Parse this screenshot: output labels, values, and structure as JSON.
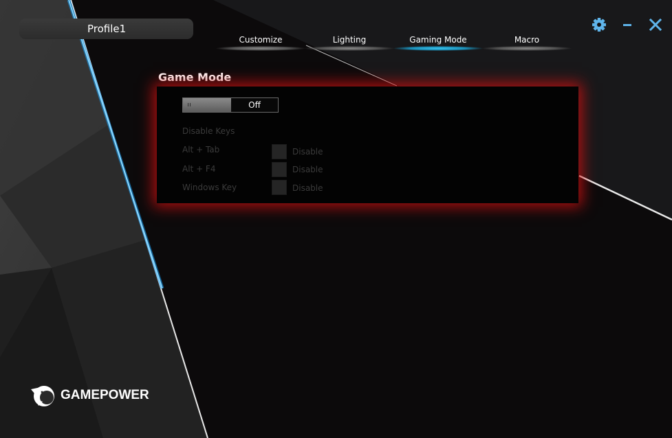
{
  "profile": {
    "name": "Profile1"
  },
  "tabs": [
    {
      "label": "Customize",
      "active": false
    },
    {
      "label": "Lighting",
      "active": false
    },
    {
      "label": "Gaming Mode",
      "active": true
    },
    {
      "label": "Macro",
      "active": false
    }
  ],
  "window": {
    "settings_icon": "gear-icon",
    "minimize_icon": "minimize-icon",
    "close_icon": "close-icon"
  },
  "game_mode": {
    "title": "Game Mode",
    "toggle_state": "Off",
    "disable_keys_label": "Disable Keys",
    "keys": [
      {
        "name": "Alt + Tab",
        "action": "Disable"
      },
      {
        "name": "Alt + F4",
        "action": "Disable"
      },
      {
        "name": "Windows Key",
        "action": "Disable"
      }
    ]
  },
  "brand": {
    "name": "GAMEPOWER",
    "logo_icon": "panther-head-icon"
  },
  "colors": {
    "accent": "#3ac4ee",
    "glow": "#cd0f0f",
    "icon": "#5fb4ea"
  }
}
